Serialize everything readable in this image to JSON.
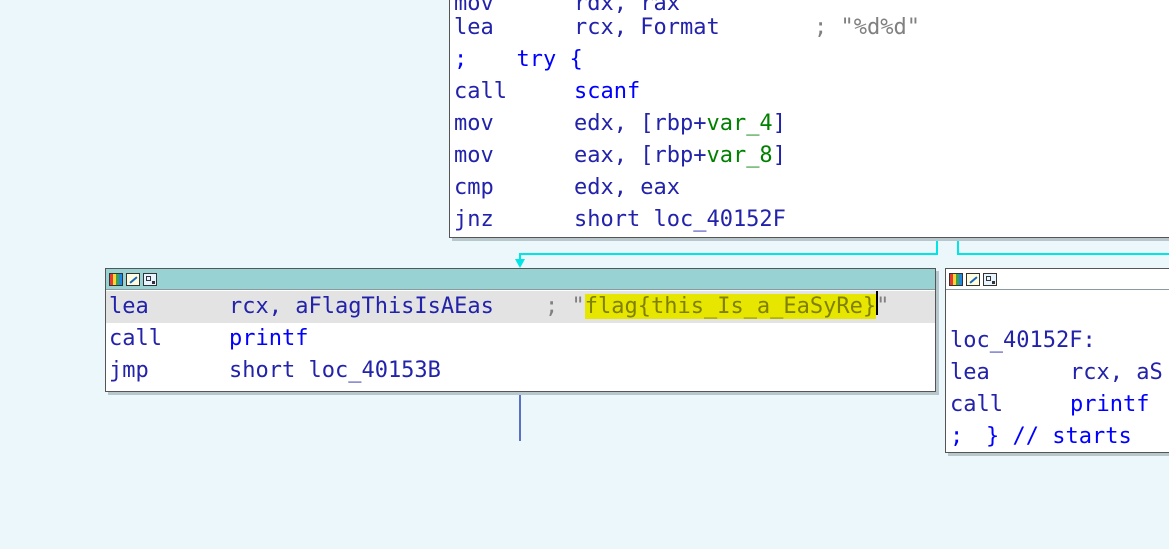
{
  "top_block": {
    "lines": [
      {
        "mn": "mov",
        "ops": "rdx, rax"
      },
      {
        "mn": "lea",
        "ops": "rcx, Format",
        "comment": "; \"%d%d\""
      },
      {
        "mn": ";",
        "ops": "  try {"
      },
      {
        "mn": "call",
        "ops": "scanf"
      },
      {
        "mn": "mov",
        "ops_a": "edx, [rbp+",
        "var": "var_4",
        "ops_b": "]"
      },
      {
        "mn": "mov",
        "ops_a": "eax, [rbp+",
        "var": "var_8",
        "ops_b": "]"
      },
      {
        "mn": "cmp",
        "ops": "edx, eax"
      },
      {
        "mn": "jnz",
        "ops": "short loc_40152F"
      }
    ]
  },
  "left_block": {
    "lines": [
      {
        "mn": "lea",
        "ops": "rcx, aFlagThisIsAEas",
        "comment_prefix": "; \"",
        "string_highlight": "flag{this_Is_a_EaSyRe}",
        "comment_suffix": "\""
      },
      {
        "mn": "call",
        "ops": "printf"
      },
      {
        "mn": "jmp",
        "ops": "short loc_40153B"
      }
    ]
  },
  "right_block": {
    "lines": [
      {
        "label": "loc_40152F:"
      },
      {
        "mn": "lea",
        "ops": "rcx, aS"
      },
      {
        "mn": "call",
        "ops": "printf"
      },
      {
        "mn": ";",
        "ops": "} // starts"
      }
    ]
  },
  "colors": {
    "background": "#ebf7fb",
    "active_titlebar": "#99d2d2",
    "edge_cyan": "#00e5e5",
    "edge_blue": "#5a70c8",
    "string_highlight": "#e6e600"
  }
}
